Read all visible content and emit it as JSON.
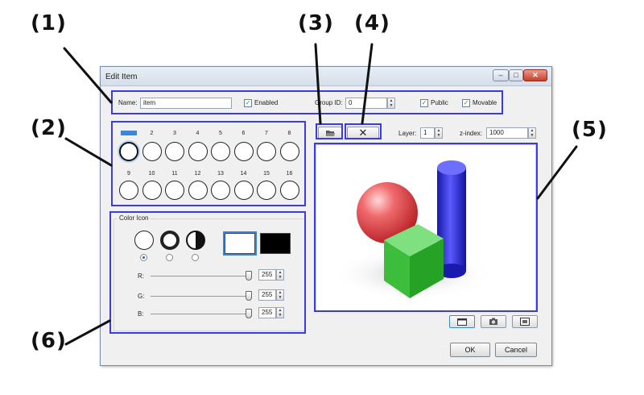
{
  "callouts": [
    "(1)",
    "(2)",
    "(3)",
    "(4)",
    "(5)",
    "(6)"
  ],
  "window": {
    "title": "Edit Item",
    "minimize": "–",
    "maximize": "□",
    "close": "✕"
  },
  "row1": {
    "name_label": "Name:",
    "name_value": "item",
    "enabled_label": "Enabled",
    "enabled_checked": true,
    "group_label": "Group ID:",
    "group_value": "0",
    "public_label": "Public",
    "public_checked": true,
    "movable_label": "Movable",
    "movable_checked": true
  },
  "slots": {
    "row1": [
      "1",
      "2",
      "3",
      "4",
      "5",
      "6",
      "7",
      "8"
    ],
    "row2": [
      "9",
      "10",
      "11",
      "12",
      "13",
      "14",
      "15",
      "16"
    ],
    "selected": "1"
  },
  "toolbar": {
    "open_icon": "folder-open-icon",
    "delete_icon": "delete-x-icon",
    "layer_label": "Layer:",
    "layer_value": "1",
    "zindex_label": "z-index:",
    "zindex_value": "1000"
  },
  "color_icon": {
    "title": "Color Icon",
    "r_label": "R:",
    "g_label": "G:",
    "b_label": "B:",
    "r_value": "255",
    "g_value": "255",
    "b_value": "255",
    "selected_style": 0
  },
  "view_buttons": [
    "window-view-icon",
    "camera-icon",
    "image-icon"
  ],
  "buttons": {
    "ok": "OK",
    "cancel": "Cancel"
  },
  "colors": {
    "highlight": "#3a3ae6",
    "slot_selected": "#3c86d9",
    "sphere": "#e8464a",
    "cylinder": "#2f2fd8",
    "cube": "#3ac13a"
  }
}
